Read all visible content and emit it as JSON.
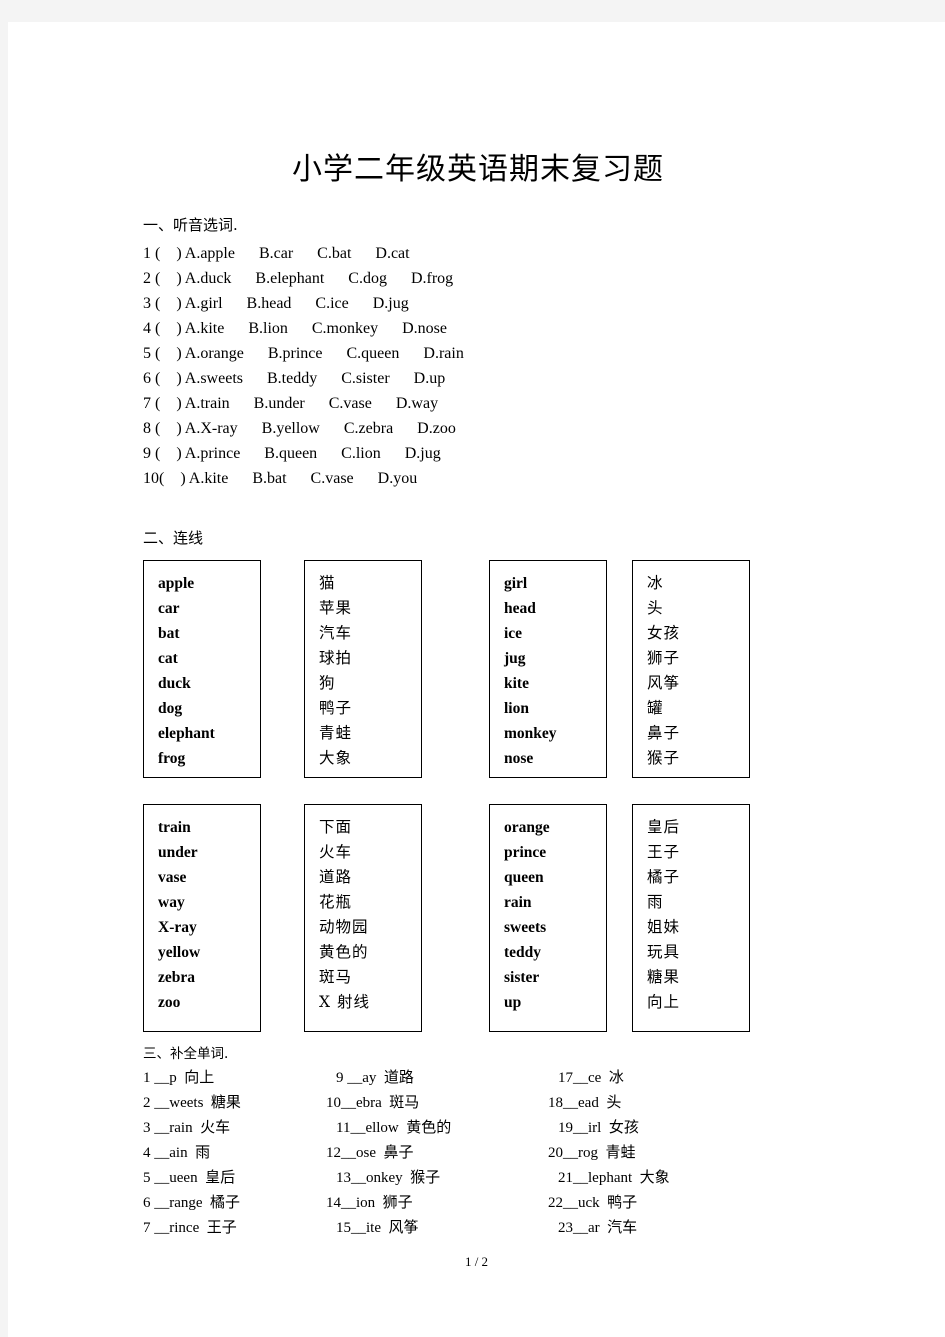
{
  "document": {
    "title": "小学二年级英语期末复习题",
    "page_indicator": "1 / 2"
  },
  "section1": {
    "heading": "一、听音选词.",
    "items": [
      "1 (    ) A.apple      B.car      C.bat      D.cat",
      "2 (    ) A.duck      B.elephant      C.dog      D.frog",
      "3 (    ) A.girl      B.head      C.ice      D.jug",
      "4 (    ) A.kite      B.lion      C.monkey      D.nose",
      "5 (    ) A.orange      B.prince      C.queen      D.rain",
      "6 (    ) A.sweets      B.teddy      C.sister      D.up",
      "7 (    ) A.train      B.under      C.vase      D.way",
      "8 (    ) A.X-ray      B.yellow      C.zebra      D.zoo",
      "9 (    ) A.prince      B.queen      C.lion      D.jug",
      "10(    ) A.kite      B.bat      C.vase      D.you"
    ]
  },
  "section2": {
    "heading": "二、连线",
    "boxes": [
      {
        "id": "box-en-1",
        "lang": "en",
        "items": [
          "apple",
          "car",
          "bat",
          "cat",
          "duck",
          "dog",
          "elephant",
          "frog"
        ]
      },
      {
        "id": "box-cn-1",
        "lang": "cn",
        "items": [
          "猫",
          "苹果",
          "汽车",
          "球拍",
          "狗",
          "鸭子",
          "青蛙",
          "大象"
        ]
      },
      {
        "id": "box-en-2",
        "lang": "en",
        "items": [
          "girl",
          "head",
          "ice",
          "jug",
          "kite",
          "lion",
          "monkey",
          "nose"
        ]
      },
      {
        "id": "box-cn-2",
        "lang": "cn",
        "items": [
          "冰",
          "头",
          "女孩",
          "狮子",
          "风筝",
          "罐",
          "鼻子",
          "猴子"
        ]
      },
      {
        "id": "box-en-3",
        "lang": "en",
        "items": [
          "train",
          "under",
          "vase",
          "way",
          "X-ray",
          "yellow",
          "zebra",
          "zoo"
        ]
      },
      {
        "id": "box-cn-3",
        "lang": "cn",
        "items": [
          "下面",
          "火车",
          "道路",
          "花瓶",
          "动物园",
          "黄色的",
          "斑马",
          "X 射线"
        ]
      },
      {
        "id": "box-en-4",
        "lang": "en",
        "items": [
          "orange",
          "prince",
          "queen",
          "rain",
          "sweets",
          "teddy",
          "sister",
          "up"
        ]
      },
      {
        "id": "box-cn-4",
        "lang": "cn",
        "items": [
          "皇后",
          "王子",
          "橘子",
          "雨",
          "姐妹",
          "玩具",
          "糖果",
          "向上"
        ]
      }
    ]
  },
  "section3": {
    "heading": "三、补全单词.",
    "column1": [
      "1 __p  向上",
      "2 __weets  糖果",
      "3 __rain  火车",
      "4 __ain  雨",
      "5 __ueen  皇后",
      "6 __range  橘子",
      "7 __rince  王子"
    ],
    "column2": [
      "9 __ay  道路",
      "10__ebra  斑马",
      "11__ellow  黄色的",
      "12__ose  鼻子",
      "13__onkey  猴子",
      "14__ion  狮子",
      "15__ite  风筝"
    ],
    "column3": [
      "17__ce  冰",
      "18__ead  头",
      "19__irl  女孩",
      "20__rog  青蛙",
      "21__lephant  大象",
      "22__uck  鸭子",
      "23__ar  汽车"
    ]
  }
}
